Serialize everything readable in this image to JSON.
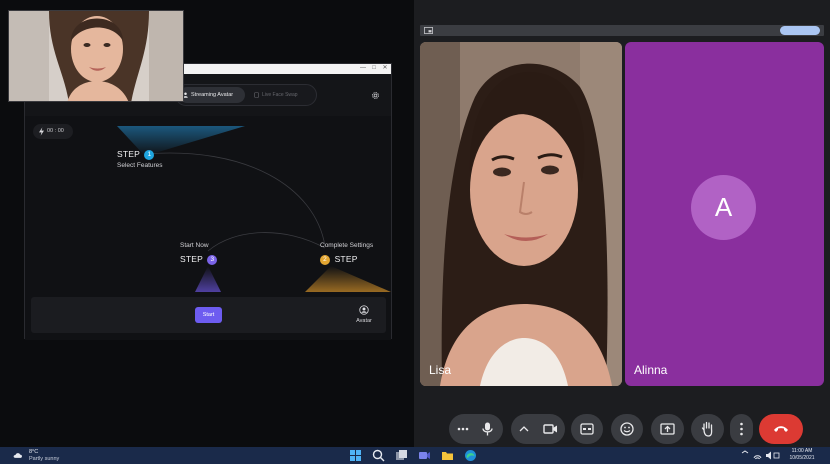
{
  "app_window": {
    "controls": [
      "—",
      "□",
      "✕"
    ],
    "tabs": [
      {
        "label": "Streaming Avatar",
        "active": true
      },
      {
        "label": "Live Face Swap",
        "active": false
      }
    ],
    "timer": "00 : 00",
    "steps": [
      {
        "prefix": "STEP",
        "number": "1",
        "caption": "Select Features",
        "color": "#1fa6e0"
      },
      {
        "prefix": "STEP",
        "number": "2",
        "caption": "Complete Settings",
        "color": "#e3a632"
      },
      {
        "prefix": "STEP",
        "number": "3",
        "caption": "Start Now",
        "color": "#7a63e8"
      }
    ],
    "start_label": "Start",
    "avatar_label": "Avatar",
    "accent": "#6d5cf0"
  },
  "meeting": {
    "participants": [
      {
        "name": "Lisa"
      },
      {
        "name": "Alinna",
        "initial": "A",
        "tile_color": "#8a2f9e",
        "avatar_color": "#b162c5"
      }
    ],
    "controls": [
      "more-options",
      "microphone",
      "camera-options",
      "camera",
      "captions",
      "emoji",
      "present",
      "raise-hand",
      "menu",
      "end-call"
    ],
    "end_call_color": "#dc3a33"
  },
  "taskbar": {
    "weather_temp": "8°C",
    "weather_desc": "Partly sunny",
    "apps": [
      "windows-start",
      "search",
      "task-view",
      "meet",
      "file-explorer",
      "edge"
    ],
    "time": "11:00 AM",
    "date": "10/05/2021"
  }
}
